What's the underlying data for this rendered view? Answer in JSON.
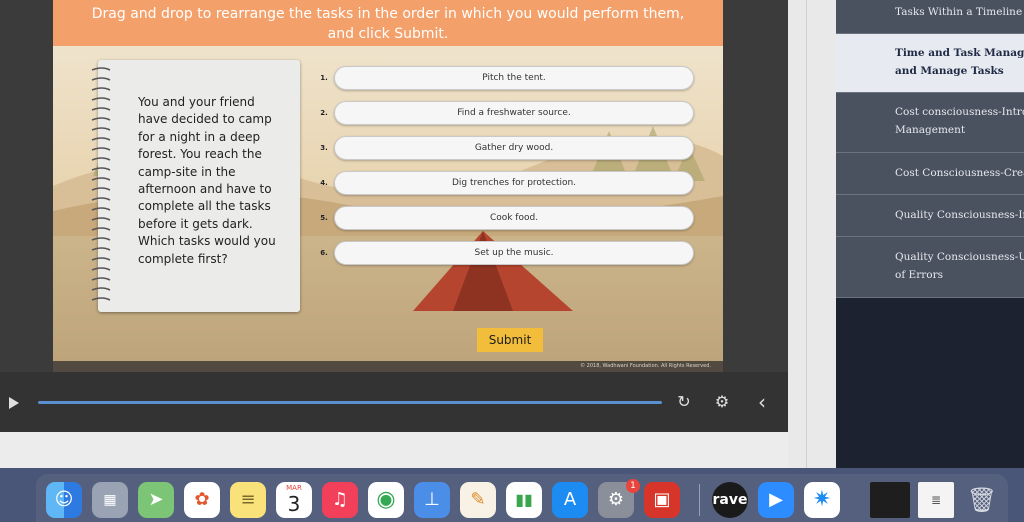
{
  "slide": {
    "instruction_line1": "Drag and drop to rearrange the tasks in the order in which you would perform them,",
    "instruction_line2": "and click Submit.",
    "scenario_text": "You and your friend have decided to camp for a night in a deep forest. You reach the camp-site in the afternoon and have to complete all the tasks before it gets dark. Which tasks would you complete first?",
    "tasks": [
      {
        "num": "1.",
        "label": "Pitch the tent."
      },
      {
        "num": "2.",
        "label": "Find a freshwater source."
      },
      {
        "num": "3.",
        "label": "Gather dry wood."
      },
      {
        "num": "4.",
        "label": "Dig trenches for protection."
      },
      {
        "num": "5.",
        "label": "Cook food."
      },
      {
        "num": "6.",
        "label": "Set up the music."
      }
    ],
    "submit_label": "Submit",
    "copyright": "© 2018, Wadhwani Foundation. All Rights Reserved."
  },
  "player": {
    "play_icon": "play-icon",
    "replay_icon": "↻",
    "settings_icon": "⚙",
    "collapse_icon": "‹"
  },
  "sidebar": {
    "items": [
      {
        "label": "Tasks Within a Timeline",
        "active": false
      },
      {
        "label": "Time and Task Managem",
        "label2": "and Manage Tasks",
        "active": true
      },
      {
        "label": "Cost consciousness-Introdu",
        "label2": "Management",
        "active": false
      },
      {
        "label": "Cost Consciousness-Create",
        "active": false
      },
      {
        "label": "Quality Consciousness-Intr",
        "active": false
      },
      {
        "label": "Quality Consciousness-Un",
        "label2": "of Errors",
        "active": false
      }
    ]
  },
  "dock": {
    "calendar_month": "MAR",
    "calendar_day": "3",
    "appstore_badge": "1",
    "rave_label": "rave",
    "apps": [
      "finder-icon",
      "launchpad-icon",
      "maps-icon",
      "photos-icon",
      "notes-icon",
      "calendar-icon",
      "music-icon",
      "chrome-icon",
      "keynote-icon",
      "pages-icon",
      "numbers-icon",
      "app-store-icon",
      "system-preferences-icon",
      "photo-booth-icon",
      "rave-icon",
      "zoom-icon",
      "safari-icon",
      "window-thumb-icon",
      "document-thumb-icon",
      "trash-icon"
    ]
  },
  "colors": {
    "header_orange": "#f4a06a",
    "submit_yellow": "#f2bd3a",
    "progress_blue": "#5a8fd1",
    "sidebar_bg": "#4a5260"
  }
}
